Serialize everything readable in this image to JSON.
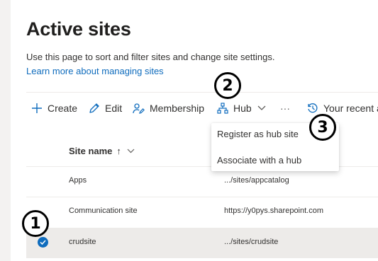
{
  "page": {
    "title": "Active sites",
    "description": "Use this page to sort and filter sites and change site settings.",
    "learn_more": "Learn more about managing sites"
  },
  "toolbar": {
    "create": "Create",
    "edit": "Edit",
    "membership": "Membership",
    "hub": "Hub",
    "more": "···",
    "recent": "Your recent a"
  },
  "hub_menu": {
    "items": [
      "Register as hub site",
      "Associate with a hub"
    ]
  },
  "table": {
    "column_site_name": "Site name",
    "sort_indicator": "↑",
    "rows": [
      {
        "name": "Apps",
        "url": ".../sites/appcatalog",
        "selected": false
      },
      {
        "name": "Communication site",
        "url": "https://y0pys.sharepoint.com",
        "selected": false
      },
      {
        "name": "crudsite",
        "url": ".../sites/crudsite",
        "selected": true
      }
    ]
  },
  "callouts": [
    "1",
    "2",
    "3"
  ],
  "colors": {
    "accent": "#0f6cbd",
    "selected_row": "#edebe9"
  }
}
